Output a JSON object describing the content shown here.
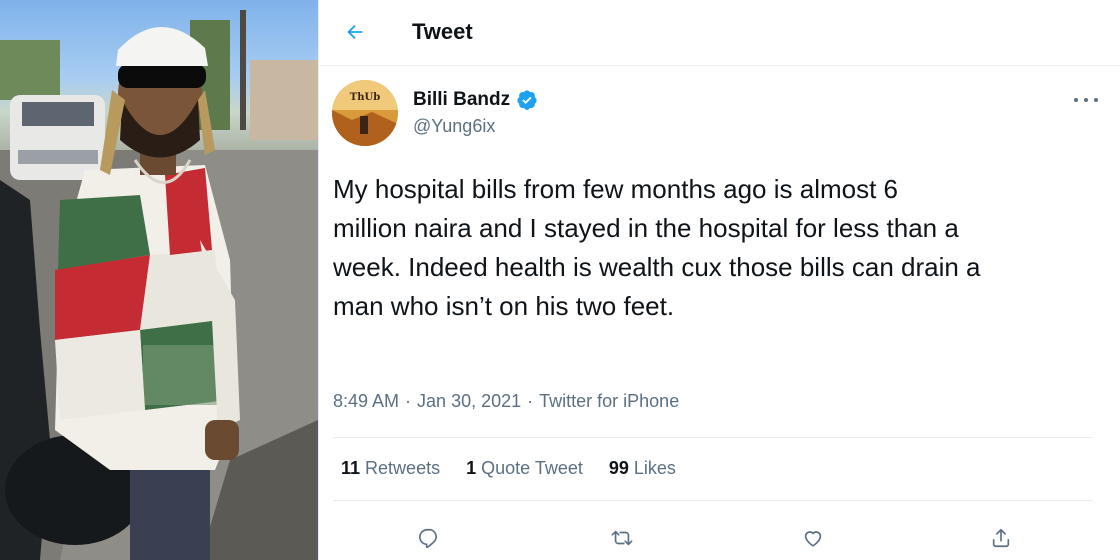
{
  "header": {
    "title": "Tweet",
    "back_icon": "arrow-left-icon"
  },
  "author": {
    "name": "Billi Bandz",
    "handle": "@Yung6ix",
    "verified": true,
    "avatar_text": "ThUb"
  },
  "tweet": {
    "lines": [
      "My hospital bills from few months ago  is almost 6",
      "million naira and I stayed in the hospital for less than a",
      "week. Indeed health is wealth cux those bills can drain a",
      "man who isn’t on his two feet."
    ],
    "time": "8:49 AM",
    "separator": "·",
    "date": "Jan 30, 2021",
    "source": "Twitter for iPhone"
  },
  "stats": {
    "retweets_count": "11",
    "retweets_label": "Retweets",
    "quotes_count": "1",
    "quotes_label": "Quote Tweet",
    "likes_count": "99",
    "likes_label": "Likes"
  },
  "icons": [
    "reply-icon",
    "retweet-icon",
    "like-icon",
    "share-icon",
    "more-icon",
    "verified-badge-icon"
  ],
  "colors": {
    "accent": "#1da1f2",
    "text": "#0f1419",
    "secondary": "#5b7083",
    "divider": "#e6ecf0"
  }
}
